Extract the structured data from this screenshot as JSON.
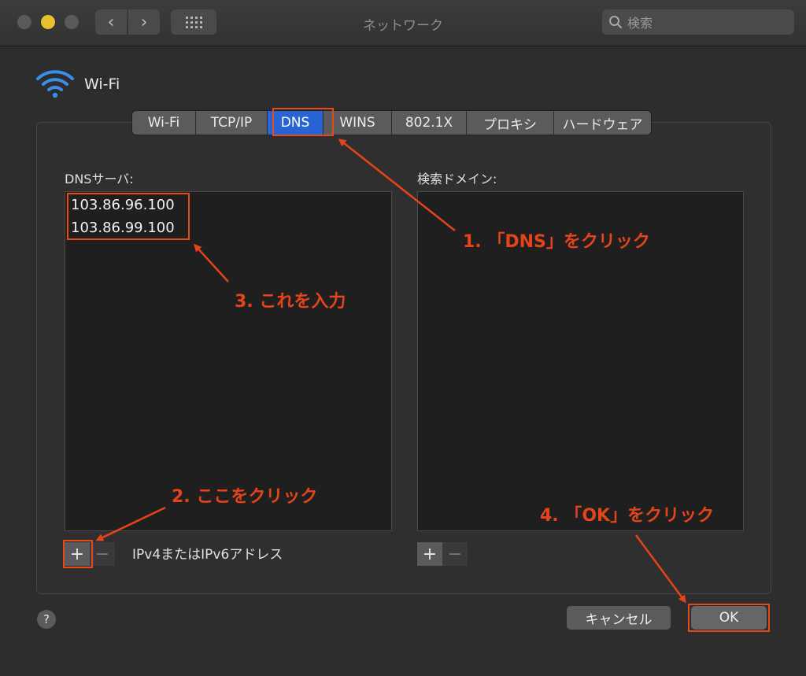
{
  "window": {
    "title": "ネットワーク"
  },
  "search": {
    "placeholder": "検索"
  },
  "interface": {
    "name": "Wi-Fi"
  },
  "tabs": [
    {
      "label": "Wi-Fi"
    },
    {
      "label": "TCP/IP"
    },
    {
      "label": "DNS"
    },
    {
      "label": "WINS"
    },
    {
      "label": "802.1X"
    },
    {
      "label": "プロキシ"
    },
    {
      "label": "ハードウェア"
    }
  ],
  "dns": {
    "label": "DNSサーバ:",
    "servers": [
      "103.86.96.100",
      "103.86.99.100"
    ],
    "hint": "IPv4またはIPv6アドレス"
  },
  "domains": {
    "label": "検索ドメイン:"
  },
  "controls": {
    "plus": "+",
    "minus": "−",
    "help": "?"
  },
  "buttons": {
    "cancel": "キャンセル",
    "ok": "OK"
  },
  "annotations": {
    "step1": "1. 「DNS」をクリック",
    "step2": "2. ここをクリック",
    "step3": "3. これを入力",
    "step4": "4. 「OK」をクリック"
  },
  "colors": {
    "accent": "#2864d4",
    "annotation": "#e5431a"
  }
}
